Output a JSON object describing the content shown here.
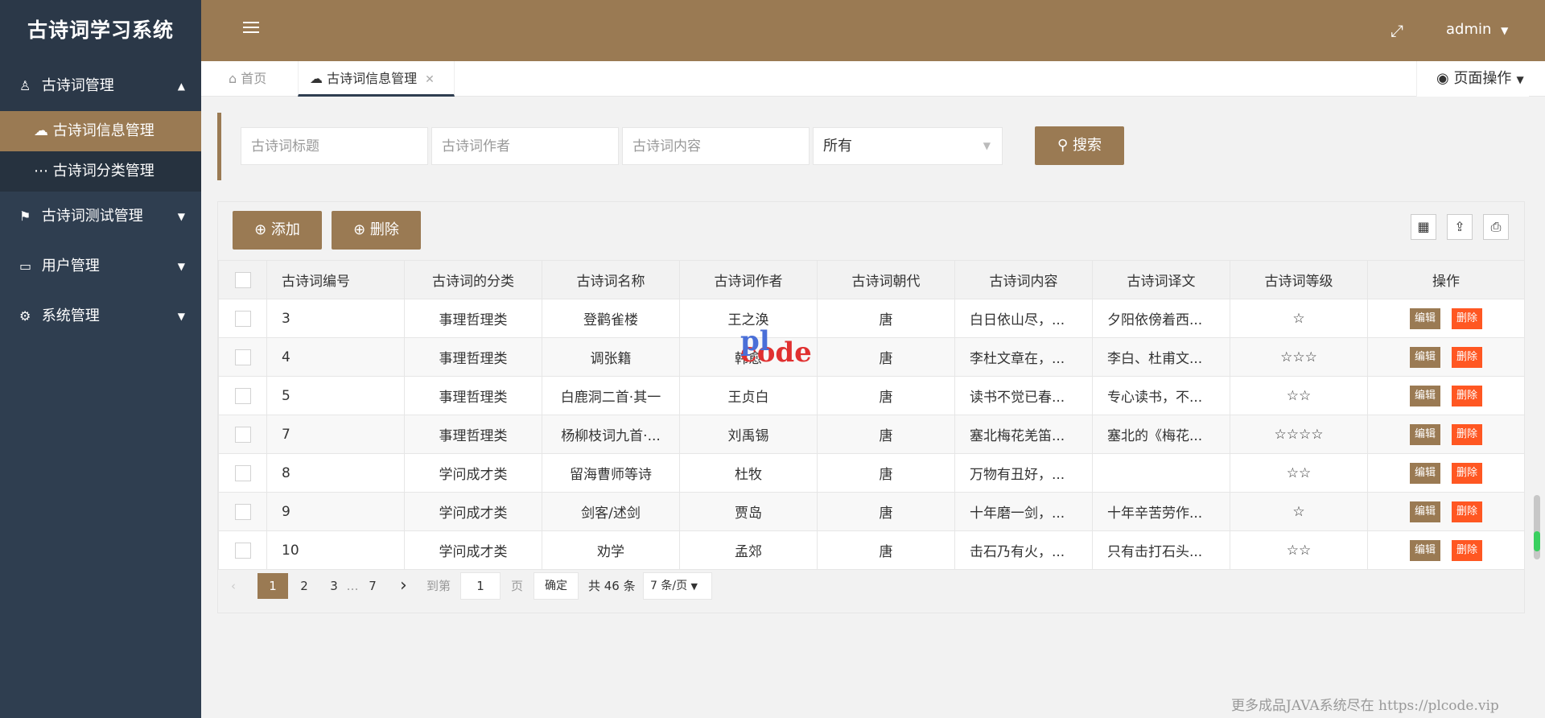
{
  "app": {
    "title": "古诗词学习系统"
  },
  "sidebar": {
    "items": [
      {
        "label": "古诗词管理",
        "icon": "person-icon",
        "open": true,
        "children": [
          {
            "label": "古诗词信息管理",
            "icon": "cloud-icon",
            "active": true
          },
          {
            "label": "古诗词分类管理",
            "icon": "dots-icon",
            "active": false
          }
        ]
      },
      {
        "label": "古诗词测试管理",
        "icon": "flag-icon"
      },
      {
        "label": "用户管理",
        "icon": "monitor-icon"
      },
      {
        "label": "系统管理",
        "icon": "gears-icon"
      }
    ]
  },
  "header": {
    "user": "admin"
  },
  "tabs": {
    "home": "首页",
    "current": "古诗词信息管理",
    "page_ops": "页面操作"
  },
  "search": {
    "title_placeholder": "古诗词标题",
    "author_placeholder": "古诗词作者",
    "content_placeholder": "古诗词内容",
    "select_value": "所有",
    "button": "搜索"
  },
  "toolbar": {
    "add": "添加",
    "delete": "删除"
  },
  "table": {
    "columns": [
      "古诗词编号",
      "古诗词的分类",
      "古诗词名称",
      "古诗词作者",
      "古诗词朝代",
      "古诗词内容",
      "古诗词译文",
      "古诗词等级",
      "操作"
    ],
    "edit_label": "编辑",
    "delete_label": "删除",
    "rows": [
      {
        "id": "3",
        "category": "事理哲理类",
        "name": "登鹳雀楼",
        "author": "王之涣",
        "dynasty": "唐",
        "content": "白日依山尽，...",
        "translation": "夕阳依傍着西...",
        "level": "☆"
      },
      {
        "id": "4",
        "category": "事理哲理类",
        "name": "调张籍",
        "author": "韩愈",
        "dynasty": "唐",
        "content": "李杜文章在，...",
        "translation": "李白、杜甫文...",
        "level": "☆☆☆"
      },
      {
        "id": "5",
        "category": "事理哲理类",
        "name": "白鹿洞二首·其一",
        "author": "王贞白",
        "dynasty": "唐",
        "content": "读书不觉已春...",
        "translation": "专心读书，不...",
        "level": "☆☆"
      },
      {
        "id": "7",
        "category": "事理哲理类",
        "name": "杨柳枝词九首·...",
        "author": "刘禹锡",
        "dynasty": "唐",
        "content": "塞北梅花羌笛...",
        "translation": "塞北的《梅花...",
        "level": "☆☆☆☆"
      },
      {
        "id": "8",
        "category": "学问成才类",
        "name": "留海曹师等诗",
        "author": "杜牧",
        "dynasty": "唐",
        "content": "万物有丑好，...",
        "translation": "",
        "level": "☆☆"
      },
      {
        "id": "9",
        "category": "学问成才类",
        "name": "剑客/述剑",
        "author": "贾岛",
        "dynasty": "唐",
        "content": "十年磨一剑，...",
        "translation": "十年辛苦劳作...",
        "level": "☆"
      },
      {
        "id": "10",
        "category": "学问成才类",
        "name": "劝学",
        "author": "孟郊",
        "dynasty": "唐",
        "content": "击石乃有火，...",
        "translation": "只有击打石头...",
        "level": "☆☆"
      }
    ]
  },
  "pagination": {
    "pages": [
      "1",
      "2",
      "3",
      "…",
      "7"
    ],
    "goto_label": "到第",
    "goto_value": "1",
    "page_unit": "页",
    "confirm": "确定",
    "total": "共 46 条",
    "page_size": "7 条/页"
  },
  "watermark": {
    "top": "pl",
    "bottom": "code"
  },
  "footer_note": "更多成品JAVA系统尽在 https://plcode.vip",
  "colors": {
    "brand": "#9a7a53",
    "sidebar": "#2f3e50",
    "danger": "#ff5722"
  }
}
